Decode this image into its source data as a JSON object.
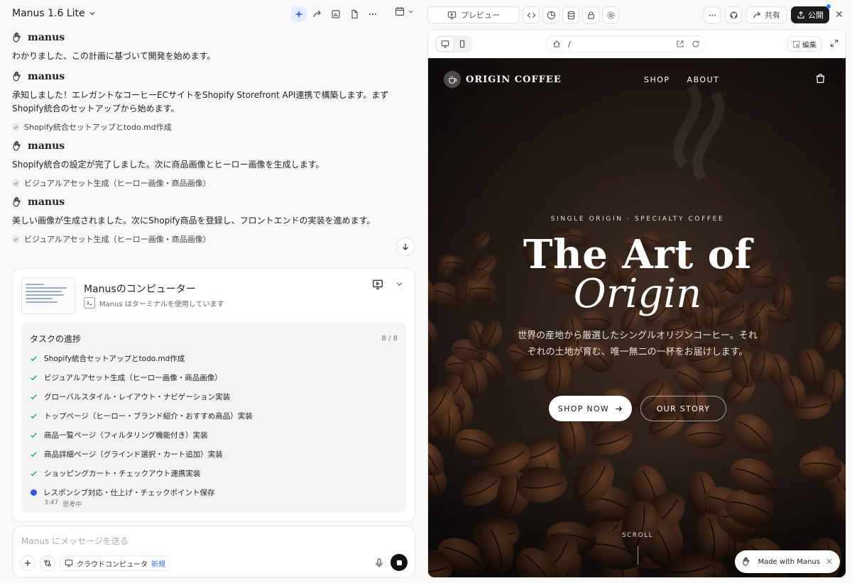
{
  "header": {
    "model_name": "Manus 1.6 Lite",
    "preview_label": "プレビュー",
    "share_label": "共有",
    "publish_label": "公開",
    "accent_color": "#3a6ee8"
  },
  "chat": {
    "agent_name": "manus",
    "messages": [
      {
        "text": "わかりました、この計画に基づいて開発を始めます。"
      },
      {
        "text": "承知しました！エレガントなコーヒーECサイトをShopify Storefront API連携で構築します。まずShopify統合のセットアップから始めます。",
        "step": "Shopify統合セットアップとtodo.md作成"
      },
      {
        "text": "Shopify統合の設定が完了しました。次に商品画像とヒーロー画像を生成します。",
        "step": "ビジュアルアセット生成（ヒーロー画像・商品画像）"
      },
      {
        "text": "美しい画像が生成されました。次にShopify商品を登録し、フロントエンドの実装を進めます。",
        "step": "ビジュアルアセット生成（ヒーロー画像・商品画像）"
      }
    ]
  },
  "computer": {
    "title": "Manusのコンピューター",
    "status": "Manus はターミナルを使用しています",
    "tasks_title": "タスクの進捗",
    "tasks_count": "8 / 8",
    "tasks": [
      "Shopify統合セットアップとtodo.md作成",
      "ビジュアルアセット生成（ヒーロー画像・商品画像）",
      "グローバルスタイル・レイアウト・ナビゲーション実装",
      "トップページ（ヒーロー・ブランド紹介・おすすめ商品）実装",
      "商品一覧ページ（フィルタリング機能付き）実装",
      "商品詳細ページ（グラインド選択・カート追加）実装",
      "ショッピングカート・チェックアウト連携実装",
      "レスポンシブ対応・仕上げ・チェックポイント保存"
    ],
    "current_time": "3:47",
    "current_state": "思考中"
  },
  "composer": {
    "placeholder": "Manus にメッセージを送る",
    "cloud_label": "クラウドコンピュータ",
    "new_badge": "新規"
  },
  "preview": {
    "url": "/",
    "edit_label": "編集",
    "site": {
      "brand": "ORIGIN COFFEE",
      "nav": [
        "SHOP",
        "ABOUT"
      ],
      "eyebrow": "SINGLE ORIGIN · SPECIALTY COFFEE",
      "headline_1": "The Art of",
      "headline_2": "Origin",
      "lead": "世界の産地から厳選したシングルオリジンコーヒー。それぞれの土地が育む、唯一無二の一杯をお届けします。",
      "cta_primary": "SHOP NOW",
      "cta_secondary": "OUR STORY",
      "scroll_label": "SCROLL"
    },
    "made_with": "Made with Manus"
  }
}
